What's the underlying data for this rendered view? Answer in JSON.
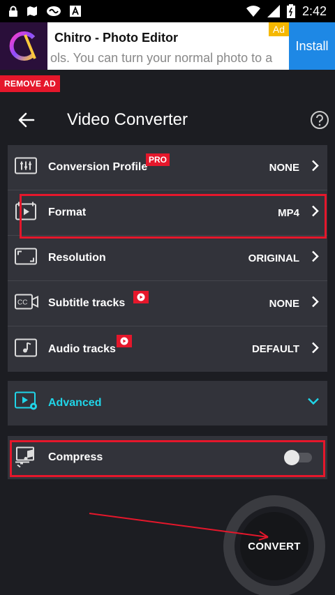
{
  "status_bar": {
    "time": "2:42"
  },
  "ad": {
    "title": "Chitro - Photo Editor",
    "subtitle": "ols. You can turn your normal photo to a",
    "tag": "Ad",
    "install_label": "Install"
  },
  "remove_ad_label": "REMOVE AD",
  "header": {
    "title": "Video Converter"
  },
  "settings": [
    {
      "label": "Conversion Profile",
      "value": "NONE",
      "badge": "PRO"
    },
    {
      "label": "Format",
      "value": "MP4"
    },
    {
      "label": "Resolution",
      "value": "ORIGINAL"
    },
    {
      "label": "Subtitle tracks",
      "value": "NONE"
    },
    {
      "label": "Audio tracks",
      "value": "DEFAULT"
    }
  ],
  "advanced": {
    "label": "Advanced"
  },
  "compress": {
    "label": "Compress",
    "enabled": false
  },
  "convert_label": "CONVERT",
  "colors": {
    "accent": "#20d5e8",
    "highlight": "#e5172b",
    "background": "#1c1d22",
    "card": "#32333a"
  }
}
